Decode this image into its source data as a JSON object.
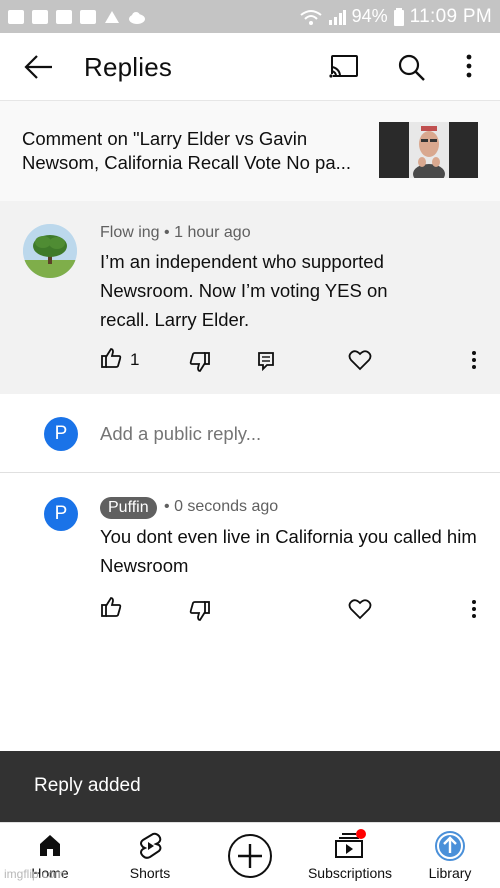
{
  "status_bar": {
    "battery": "94%",
    "time": "11:09 PM"
  },
  "header": {
    "title": "Replies"
  },
  "context": {
    "text": "Comment on \"Larry Elder vs Gavin Newsom, California Recall Vote No pa..."
  },
  "comment": {
    "author": "Flow ing",
    "separator": "•",
    "time": "1 hour ago",
    "text": "I’m an independent who supported Newsroom. Now I’m voting YES on recall. Larry Elder.",
    "like_count": "1"
  },
  "reply_box": {
    "avatar_letter": "P",
    "placeholder": "Add a public reply..."
  },
  "reply": {
    "avatar_letter": "P",
    "author": "Puffin",
    "separator": "•",
    "time": "0 seconds ago",
    "text": "You dont even live in California you called him Newsroom"
  },
  "snackbar": {
    "text": "Reply added"
  },
  "bottom_nav": {
    "items": [
      {
        "label": "Home",
        "icon": "home-icon"
      },
      {
        "label": "Shorts",
        "icon": "shorts-icon"
      },
      {
        "label": "",
        "icon": "create-icon"
      },
      {
        "label": "Subscriptions",
        "icon": "subscriptions-icon"
      },
      {
        "label": "Library",
        "icon": "library-icon"
      }
    ]
  },
  "watermark": "imgflip.com",
  "colors": {
    "accent_blue": "#1a73e8",
    "library_blue": "#4a90d9",
    "notification_red": "#ff0000",
    "snackbar_bg": "#323232",
    "comment_bg": "#f2f2f2"
  }
}
